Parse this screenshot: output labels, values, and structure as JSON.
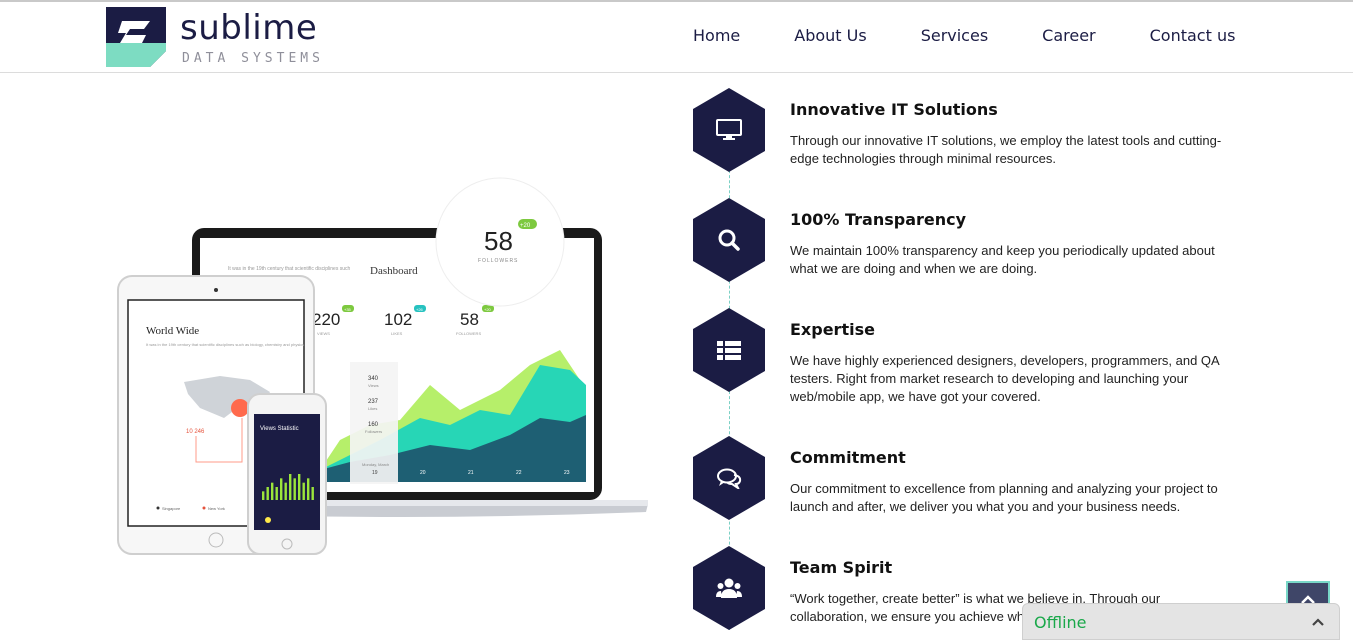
{
  "brand": {
    "name": "sublime",
    "tagline": "DATA SYSTEMS",
    "colors": {
      "navy": "#1b1c44",
      "mint": "#7ddcc2"
    }
  },
  "nav": {
    "items": [
      {
        "label": "Home"
      },
      {
        "label": "About Us"
      },
      {
        "label": "Services"
      },
      {
        "label": "Career"
      },
      {
        "label": "Contact us"
      }
    ]
  },
  "illustration": {
    "laptop": {
      "dashboard_title": "Dashboard",
      "intro_text": "It was in the 19th century that scientific disciplines such",
      "stats": [
        {
          "value": "220",
          "badge": "+35",
          "label": "VIEWS"
        },
        {
          "value": "102",
          "badge": "+26",
          "label": "LIKES"
        },
        {
          "value": "58",
          "badge": "+20",
          "label": "FOLLOWERS"
        }
      ],
      "tooltip": [
        {
          "value": "340",
          "label": "Views"
        },
        {
          "value": "237",
          "label": "Likes"
        },
        {
          "value": "160",
          "label": "Followers"
        }
      ],
      "tooltip_footer": "Monday, March",
      "x_labels": [
        "19",
        "20",
        "21",
        "22",
        "23"
      ]
    },
    "bubble": {
      "value": "58",
      "badge": "+20",
      "label": "FOLLOWERS"
    },
    "tablet": {
      "title": "World Wide",
      "text": "It was in the 19th century that scientific disciplines such as biology, chemistry and physics",
      "callout": "10 246",
      "legend": [
        "Singapore",
        "New York"
      ]
    },
    "phone": {
      "title": "Views Statistic",
      "bar_values": [
        2,
        3,
        4,
        3,
        5,
        4,
        6,
        5,
        6,
        4,
        5,
        3
      ]
    }
  },
  "features": [
    {
      "icon": "monitor-icon",
      "title": "Innovative IT Solutions",
      "text": "Through our innovative IT solutions, we employ the latest tools and cutting-edge technologies through minimal resources."
    },
    {
      "icon": "search-icon",
      "title": "100% Transparency",
      "text": "We maintain 100% transparency and keep you periodically updated about what we are doing and when we are doing."
    },
    {
      "icon": "list-icon",
      "title": "Expertise",
      "text": "We have highly experienced designers, developers, programmers, and QA testers. Right from market  research to developing and launching your web/mobile app, we have got your covered."
    },
    {
      "icon": "chat-icon",
      "title": "Commitment",
      "text": "Our commitment to excellence  from planning and analyzing your project to launch and after, we deliver you what you and your business needs."
    },
    {
      "icon": "users-icon",
      "title": "Team Spirit",
      "text": "“Work together, create better” is what we believe in. Through our collaboration, we ensure you achieve what you envision."
    }
  ],
  "chat_widget": {
    "status": "Offline",
    "status_color": "#1aa84a"
  }
}
